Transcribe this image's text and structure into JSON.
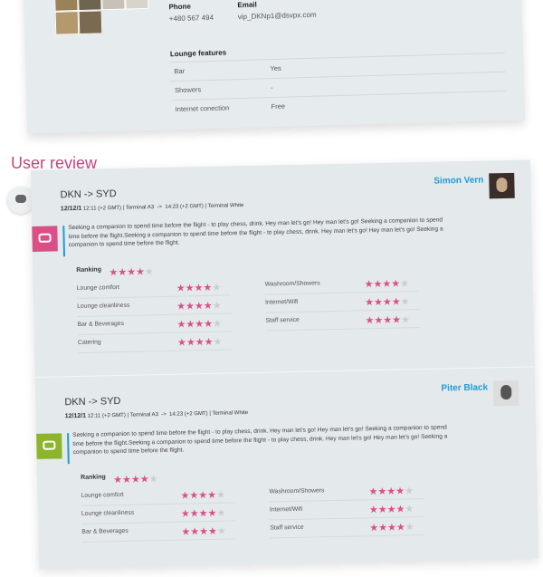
{
  "lounge_info": {
    "phone_label": "Phone",
    "phone_value": "+480 567 494",
    "email_label": "Email",
    "email_value": "vip_DKNp1@dsvpx.com",
    "features_title": "Lounge features",
    "features": [
      {
        "name": "Bar",
        "value": "Yes"
      },
      {
        "name": "Showers",
        "value": "-"
      },
      {
        "name": "Internet conection",
        "value": "Free"
      }
    ]
  },
  "section_title": "User review",
  "reviews": [
    {
      "route": "DKN -> SYD",
      "date": "12/12/1",
      "departure": "12:11 (+2 GMT)",
      "terminal_from": "Terminal A3",
      "arrow": "->",
      "arrival": "14:23 (+2 GMT)",
      "terminal_to": "Terminal White",
      "user_name": "Simon Vern",
      "badge_color": "#d94f87",
      "text": "Seeking a companion to spend time before the flight - to play chess, drink. Hey man let's go! Hey man let's go! Seeking a companion to spend time before the flight.Seeking a companion to spend time before the flight - to play chess, drink. Hey man let's go! Hey man let's go! Seeking a companion to spend time before the flight.",
      "ranking_label": "Ranking",
      "ranking": 4,
      "criteria": [
        {
          "name": "Lounge comfort",
          "stars": 4
        },
        {
          "name": "Lounge cleanliness",
          "stars": 4
        },
        {
          "name": "Bar & Beverages",
          "stars": 4
        },
        {
          "name": "Catering",
          "stars": 4
        },
        {
          "name": "Washroom/Showers",
          "stars": 4
        },
        {
          "name": "Internet/Wifi",
          "stars": 4
        },
        {
          "name": "Staff service",
          "stars": 4
        }
      ]
    },
    {
      "route": "DKN -> SYD",
      "date": "12/12/1",
      "departure": "12:11 (+2 GMT)",
      "terminal_from": "Terminal A3",
      "arrow": "->",
      "arrival": "14:23 (+2 GMT)",
      "terminal_to": "Terminal White",
      "user_name": "Piter Black",
      "badge_color": "#8cb52c",
      "text": "Seeking a companion to spend time before the flight - to play chess, drink. Hey man let's go! Hey man let's go! Seeking a companion to spend time before the flight.Seeking a companion to spend time before the flight - to play chess, drink. Hey man let's go! Hey man let's go! Seeking a companion to spend time before the flight.",
      "ranking_label": "Ranking",
      "ranking": 4,
      "criteria": [
        {
          "name": "Lounge comfort",
          "stars": 4
        },
        {
          "name": "Lounge cleanliness",
          "stars": 4
        },
        {
          "name": "Bar & Beverages",
          "stars": 4
        },
        {
          "name": "Washroom/Showers",
          "stars": 4
        },
        {
          "name": "Internet/Wifi",
          "stars": 4
        },
        {
          "name": "Staff service",
          "stars": 4
        }
      ]
    }
  ],
  "colors": {
    "accent_pink": "#d94f87",
    "accent_blue": "#1f9bd4",
    "title_pink": "#c64580",
    "panel_gray": "#e4e9ec"
  }
}
